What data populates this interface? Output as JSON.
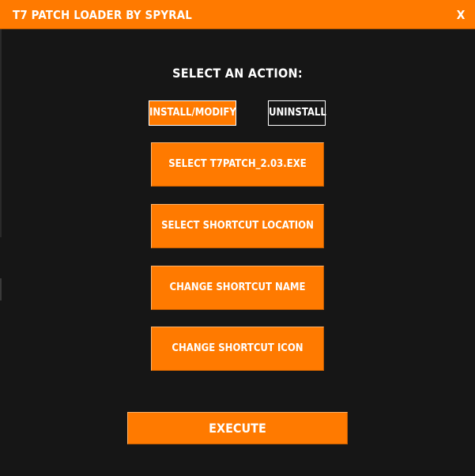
{
  "window": {
    "title": "T7 PATCH LOADER BY SPYRAL",
    "close_label": "X"
  },
  "main": {
    "heading": "SELECT AN ACTION:",
    "mode_options": [
      {
        "label": "INSTALL/MODIFY",
        "selected": true
      },
      {
        "label": "UNINSTALL",
        "selected": false
      }
    ],
    "actions": [
      {
        "label": "SELECT T7PATCH_2.03.EXE"
      },
      {
        "label": "SELECT SHORTCUT LOCATION"
      },
      {
        "label": "CHANGE SHORTCUT NAME"
      },
      {
        "label": "CHANGE SHORTCUT ICON"
      }
    ],
    "execute_label": "EXECUTE"
  },
  "theme": {
    "accent": "#ff7a00",
    "background": "#161616",
    "text": "#ffffff"
  }
}
